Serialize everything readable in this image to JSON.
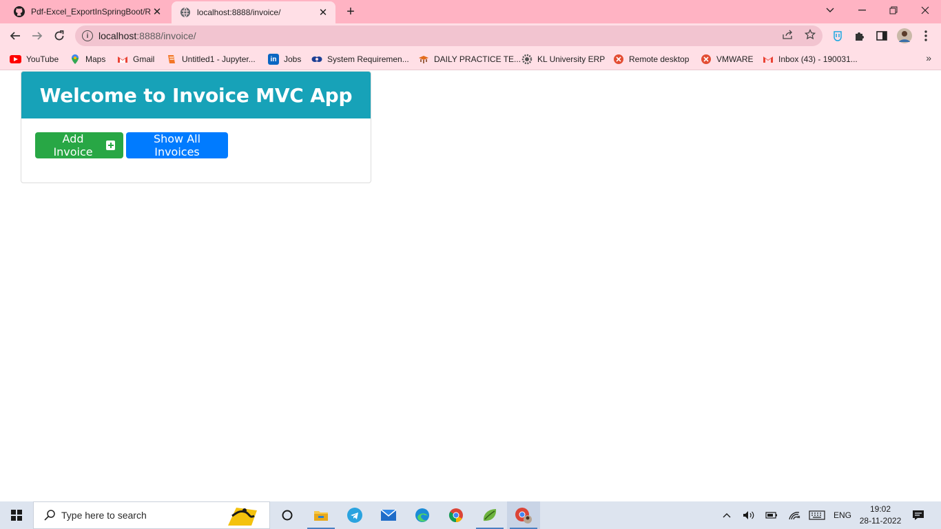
{
  "browser": {
    "tabs": [
      {
        "title": "Pdf-Excel_ExportInSpringBoot/RE",
        "icon": "github-icon",
        "active": false
      },
      {
        "title": "localhost:8888/invoice/",
        "icon": "globe-icon",
        "active": true
      }
    ],
    "address": {
      "host": "localhost",
      "path": ":8888/invoice/"
    },
    "bookmarks": [
      {
        "label": "YouTube",
        "icon": "youtube-icon"
      },
      {
        "label": "Maps",
        "icon": "maps-icon"
      },
      {
        "label": "Gmail",
        "icon": "gmail-icon"
      },
      {
        "label": "Untitled1 - Jupyter...",
        "icon": "jupyter-icon"
      },
      {
        "label": "Jobs",
        "icon": "linkedin-icon"
      },
      {
        "label": "System Requiremen...",
        "icon": "bookmark-icon"
      },
      {
        "label": "DAILY PRACTICE TE...",
        "icon": "bookmark-icon"
      },
      {
        "label": "KL University ERP",
        "icon": "gear-icon"
      },
      {
        "label": "Remote desktop",
        "icon": "remote-icon"
      },
      {
        "label": "VMWARE",
        "icon": "remote-icon"
      },
      {
        "label": "Inbox (43) - 190031...",
        "icon": "gmail-icon"
      }
    ]
  },
  "page": {
    "heading": "Welcome to Invoice MVC App",
    "add_button": "Add Invoice",
    "show_button": "Show All Invoices"
  },
  "taskbar": {
    "search_placeholder": "Type here to search",
    "language": "ENG",
    "time": "19:02",
    "date": "28-11-2022"
  },
  "colors": {
    "header_bg": "#17a2b8",
    "success": "#28a745",
    "primary": "#007bff",
    "tabstrip": "#ffb3c3"
  }
}
